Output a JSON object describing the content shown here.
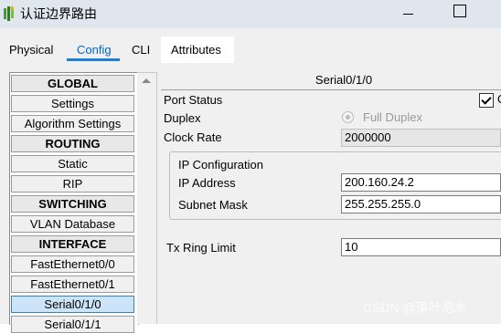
{
  "window": {
    "title": "认证边界路由"
  },
  "tabs": [
    {
      "label": "Physical"
    },
    {
      "label": "Config",
      "active": true
    },
    {
      "label": "CLI"
    },
    {
      "label": "Attributes"
    }
  ],
  "sidebar": {
    "items": [
      {
        "label": "GLOBAL",
        "type": "header"
      },
      {
        "label": "Settings"
      },
      {
        "label": "Algorithm Settings"
      },
      {
        "label": "ROUTING",
        "type": "header"
      },
      {
        "label": "Static"
      },
      {
        "label": "RIP"
      },
      {
        "label": "SWITCHING",
        "type": "header"
      },
      {
        "label": "VLAN Database"
      },
      {
        "label": "INTERFACE",
        "type": "header"
      },
      {
        "label": "FastEthernet0/0"
      },
      {
        "label": "FastEthernet0/1"
      },
      {
        "label": "Serial0/1/0",
        "selected": true
      },
      {
        "label": "Serial0/1/1"
      }
    ]
  },
  "panel": {
    "title": "Serial0/1/0",
    "port_status_label": "Port Status",
    "port_status_on": true,
    "port_status_check_label": "O",
    "duplex_label": "Duplex",
    "duplex_value": "Full Duplex",
    "clock_rate_label": "Clock Rate",
    "clock_rate_value": "2000000",
    "ip_config_label": "IP Configuration",
    "ip_address_label": "IP Address",
    "ip_address_value": "200.160.24.2",
    "subnet_mask_label": "Subnet Mask",
    "subnet_mask_value": "255.255.255.0",
    "tx_ring_limit_label": "Tx Ring Limit",
    "tx_ring_limit_value": "10"
  },
  "watermark": "CSDN @落叶泡水",
  "colors": {
    "accent": "#0066cc",
    "selected_bg": "#cce4f7",
    "titlebar": "#dfe6ee"
  }
}
